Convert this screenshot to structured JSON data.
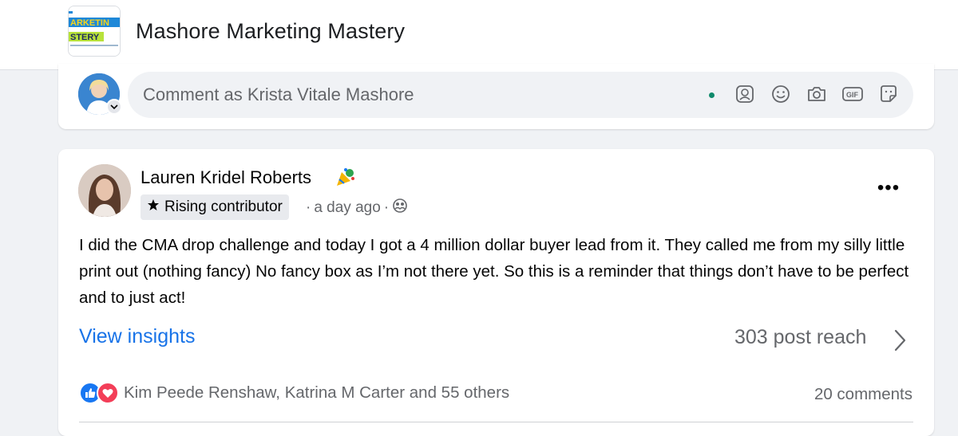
{
  "group": {
    "name": "Mashore Marketing Mastery",
    "logo_icon": "group-logo-icon"
  },
  "composer": {
    "placeholder": "Comment as Krista Vitale Mashore",
    "tools": [
      "avatar-sticker-icon",
      "emoji-icon",
      "camera-icon",
      "gif-icon",
      "sticker-icon"
    ]
  },
  "post": {
    "author": "Lauren Kridel Roberts",
    "badge": "Rising contributor",
    "time": "a day ago",
    "privacy_icon": "group-privacy-icon",
    "more_label": "•••",
    "text": "I did the CMA drop challenge and today I got a 4 million dollar buyer lead from it. They called me from my silly little print out (nothing fancy) No fancy box as I’m not there yet. So this is a reminder that things don’t have to be perfect and to just act!",
    "view_insights": "View insights",
    "reach": "303 post reach",
    "reactors": "Kim Peede Renshaw, Katrina M Carter and 55 others",
    "comments": "20 comments"
  },
  "colors": {
    "link_blue": "#1873e8",
    "like_blue": "#1877f2",
    "love_red": "#f33e58",
    "online_green": "#0f8a6b"
  }
}
